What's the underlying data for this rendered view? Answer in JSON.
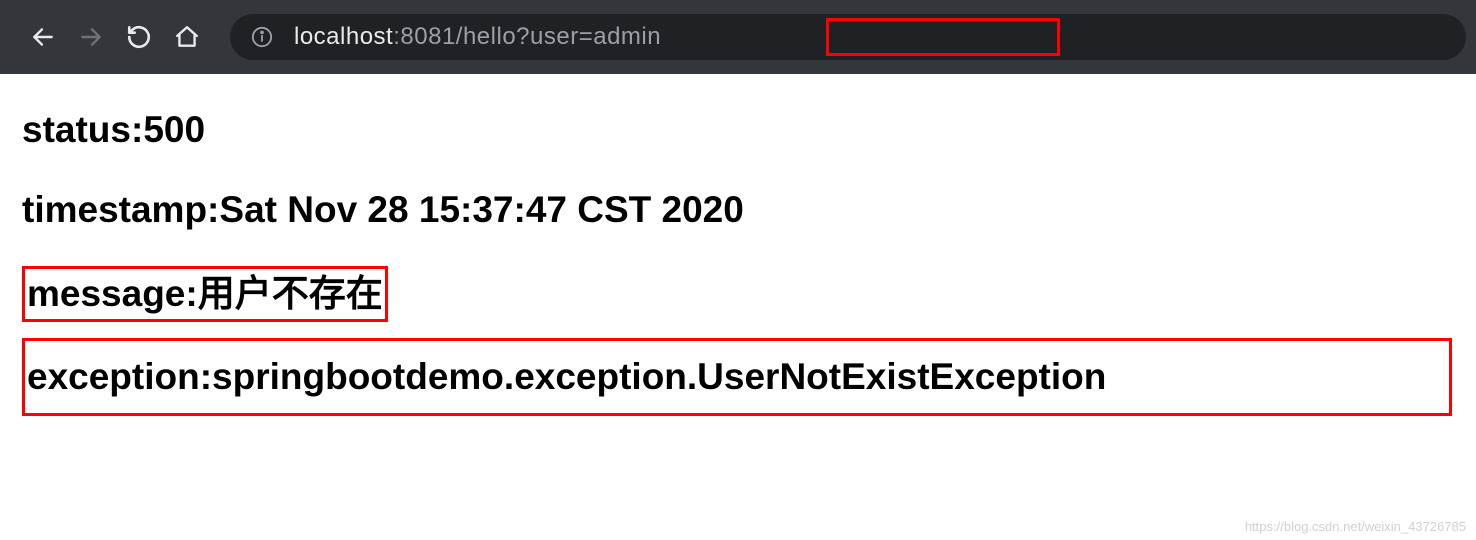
{
  "browser": {
    "url_host": "localhost",
    "url_port_path": ":8081/hello",
    "url_query": "?user=admin"
  },
  "page": {
    "status_label": "status:",
    "status_value": "500",
    "timestamp_label": "timestamp:",
    "timestamp_value": "Sat Nov 28 15:37:47 CST 2020",
    "message_label": "message:",
    "message_value": "用户不存在",
    "exception_label": "exception:",
    "exception_value": "springbootdemo.exception.UserNotExistException"
  },
  "watermark": "https://blog.csdn.net/weixin_43726785"
}
